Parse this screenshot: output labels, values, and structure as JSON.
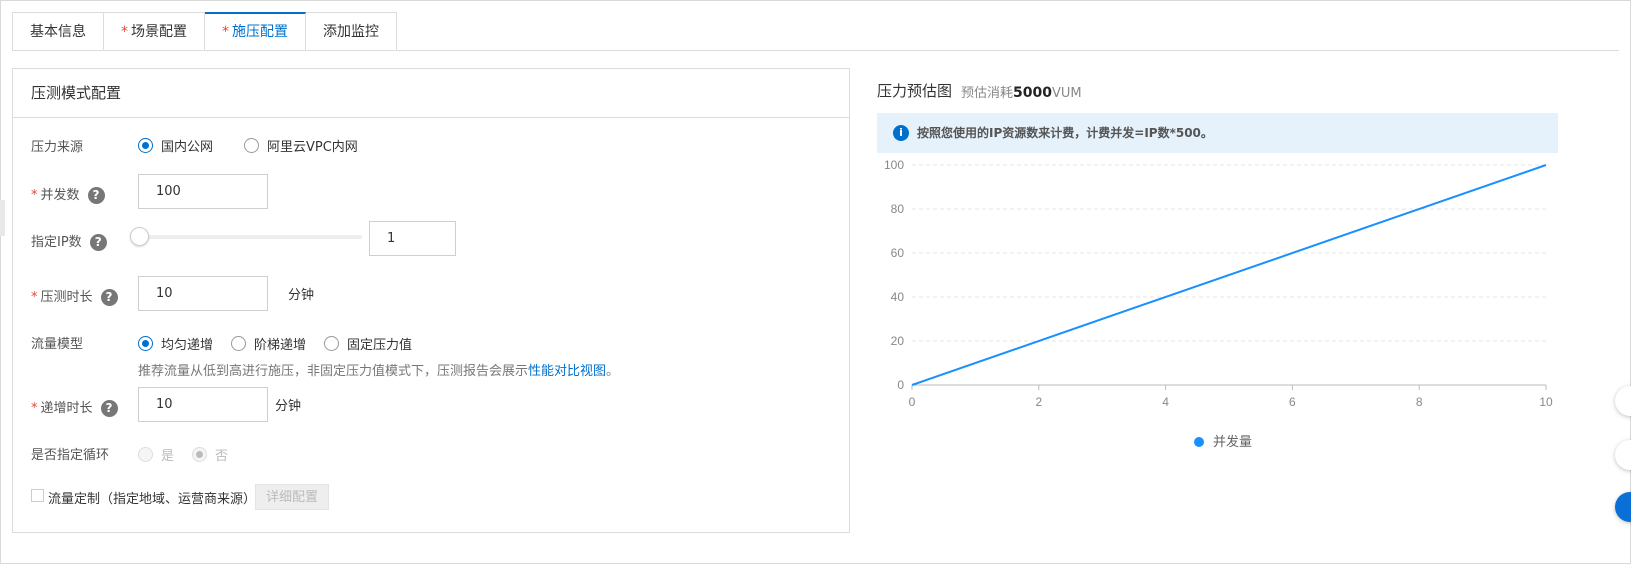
{
  "tabs": [
    {
      "label": "基本信息",
      "required": false,
      "active": false
    },
    {
      "label": "场景配置",
      "required": true,
      "active": false
    },
    {
      "label": "施压配置",
      "required": true,
      "active": true
    },
    {
      "label": "添加监控",
      "required": false,
      "active": false
    }
  ],
  "panel": {
    "title": "压测模式配置",
    "pressure_source": {
      "label": "压力来源",
      "options": [
        {
          "label": "国内公网",
          "checked": true
        },
        {
          "label": "阿里云VPC内网",
          "checked": false
        }
      ]
    },
    "concurrency": {
      "label": "并发数",
      "value": "100"
    },
    "ip_count": {
      "label": "指定IP数",
      "value": "1",
      "slider_level": 0
    },
    "duration": {
      "label": "压测时长",
      "value": "10",
      "unit": "分钟"
    },
    "traffic_model": {
      "label": "流量模型",
      "options": [
        {
          "label": "均匀递增",
          "checked": true
        },
        {
          "label": "阶梯递增",
          "checked": false
        },
        {
          "label": "固定压力值",
          "checked": false
        }
      ],
      "hint": "推荐流量从低到高进行施压，非固定压力值模式下，压测报告会展示",
      "hint_link": "性能对比视图",
      "hint_end": "。"
    },
    "ramp_duration": {
      "label": "递增时长",
      "value": "10",
      "unit": "分钟"
    },
    "loop": {
      "label": "是否指定循环",
      "options": [
        {
          "label": "是",
          "checked": false
        },
        {
          "label": "否",
          "checked": true
        }
      ]
    },
    "custom_traffic": {
      "label": "流量定制（指定地域、运营商来源）",
      "checked": false,
      "button": "详细配置"
    },
    "help_icon": "?"
  },
  "estimate": {
    "title": "压力预估图",
    "cost_prefix": "预估消耗",
    "cost_value": "5000",
    "cost_unit": "VUM",
    "notice": "按照您使用的IP资源数来计费，计费并发=IP数*500。",
    "info_icon": "i"
  },
  "colors": {
    "accent": "#0070cc",
    "line": "#1890ff",
    "required": "#e04a3a"
  },
  "chart_data": {
    "type": "line",
    "x": [
      0,
      10
    ],
    "series": [
      {
        "name": "并发量",
        "values": [
          0,
          100
        ]
      }
    ],
    "xticks": [
      "0",
      "2",
      "4",
      "6",
      "8",
      "10"
    ],
    "yticks": [
      "0",
      "20",
      "40",
      "60",
      "80",
      "100"
    ],
    "xlim": [
      0,
      10
    ],
    "ylim": [
      0,
      100
    ],
    "grid": true,
    "legend": "bottom"
  }
}
